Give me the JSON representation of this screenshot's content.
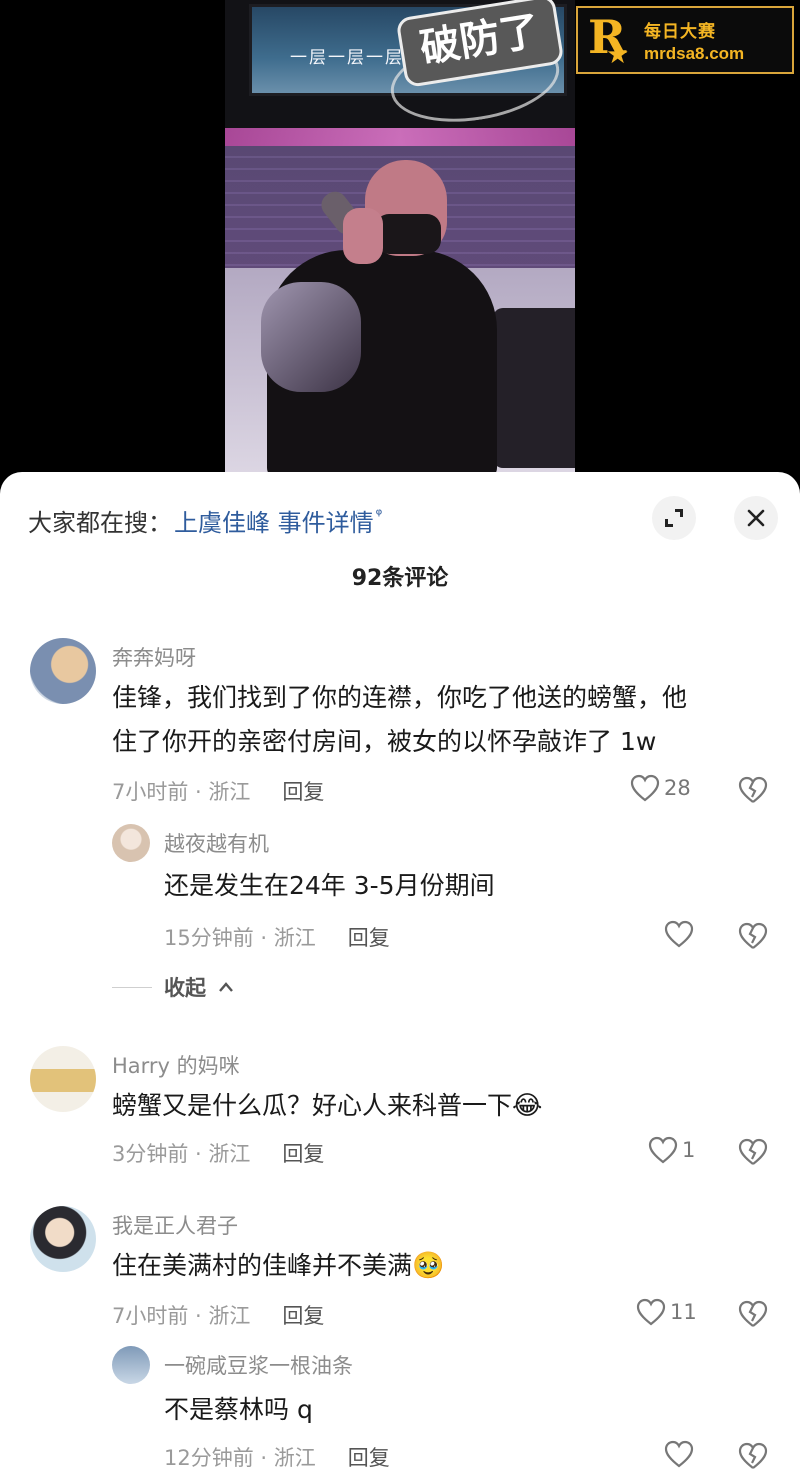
{
  "video": {
    "tv_lyrics": "一层一层一层的",
    "sticker_text": "破防了"
  },
  "watermark": {
    "logo_letter": "R",
    "cn": "每日大赛",
    "url": "mrdsa8.com"
  },
  "sheet": {
    "search_prefix": "大家都在搜：",
    "search_term": "上虞佳峰 事件详情",
    "comment_count": "92条评论",
    "collapse_label": "收起"
  },
  "comments": [
    {
      "name": "奔奔妈呀",
      "text_line1": "佳锋，我们找到了你的连襟，你吃了他送的螃蟹，他",
      "text_line2": "住了你开的亲密付房间，被女的以怀孕敲诈了 1w",
      "time": "7小时前 · 浙江",
      "reply": "回复",
      "likes": "28"
    },
    {
      "name": "越夜越有机",
      "text": "还是发生在24年 3-5月份期间",
      "time": "15分钟前 · 浙江",
      "reply": "回复",
      "likes": ""
    },
    {
      "name": "Harry 的妈咪",
      "text": "螃蟹又是什么瓜？好心人来科普一下",
      "time": "3分钟前 · 浙江",
      "reply": "回复",
      "likes": "1"
    },
    {
      "name": "我是正人君子",
      "text": "住在美满村的佳峰并不美满",
      "time": "7小时前 · 浙江",
      "reply": "回复",
      "likes": "11"
    },
    {
      "name": "一碗咸豆浆一根油条",
      "text": "不是蔡林吗 q",
      "time": "12分钟前 · 浙江",
      "reply": "回复",
      "likes": ""
    }
  ],
  "icons": {
    "heart": "heart-icon",
    "dislike": "broken-heart-icon",
    "expand": "expand-icon",
    "close": "close-icon",
    "search_glyph": "ᵠ"
  }
}
